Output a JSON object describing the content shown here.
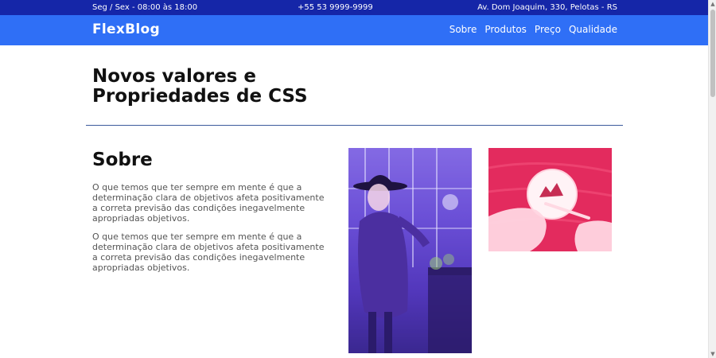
{
  "topbar": {
    "hours": "Seg / Sex - 08:00 às 18:00",
    "phone": "+55 53 9999-9999",
    "address": "Av. Dom Joaquim, 330, Pelotas - RS"
  },
  "navbar": {
    "brand": "FlexBlog",
    "links": [
      "Sobre",
      "Produtos",
      "Preço",
      "Qualidade"
    ]
  },
  "hero": {
    "title": "Novos valores e Propriedades de CSS"
  },
  "about": {
    "title": "Sobre",
    "paragraphs": [
      "O que temos que ter sempre em mente é que a determinação clara de objetivos afeta positivamente a correta previsão das condições inegavelmente apropriadas objetivos.",
      "O que temos que ter sempre em mente é que a determinação clara de objetivos afeta positivamente a correta previsão das condições inegavelmente apropriadas objetivos."
    ]
  },
  "colors": {
    "topbar": "#1526a8",
    "navbar": "#2f6ff6",
    "divider": "#3b5a9c"
  }
}
